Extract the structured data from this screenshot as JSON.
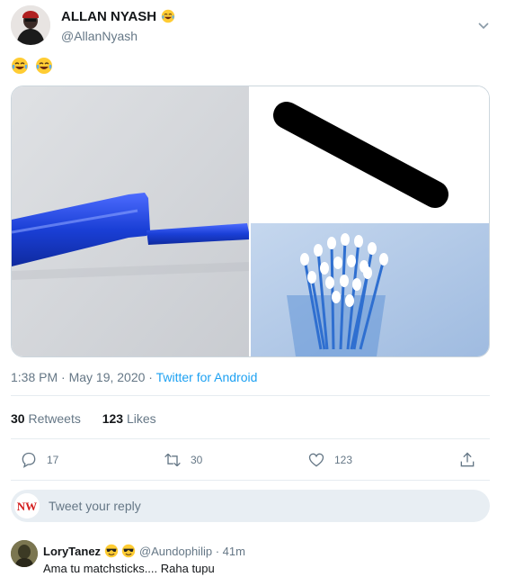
{
  "header": {
    "display_name": "ALLAN NYASH",
    "handle": "@AllanNyash",
    "name_emoji": "tears-of-joy-emoji"
  },
  "tweet": {
    "text_emojis": [
      "tears-of-joy-emoji",
      "tears-of-joy-emoji"
    ],
    "media": [
      {
        "name": "blue-pen-cap-photo"
      },
      {
        "name": "black-stroke-photo"
      },
      {
        "name": "cotton-swabs-photo"
      }
    ],
    "time": "1:38 PM · May 19, 2020 · ",
    "source": "Twitter for Android"
  },
  "stats": {
    "retweets_count": "30",
    "retweets_label": "Retweets",
    "likes_count": "123",
    "likes_label": "Likes"
  },
  "actions": {
    "reply_count": "17",
    "retweet_count": "30",
    "like_count": "123"
  },
  "reply_box": {
    "placeholder": "Tweet your reply",
    "avatar_text": "NW"
  },
  "reply": {
    "name": "LoryTanez",
    "name_emojis": [
      "sunglasses-emoji",
      "sunglasses-emoji"
    ],
    "meta": "@Aundophilip · 41m",
    "text": "Ama tu matchsticks.... Raha tupu"
  },
  "colors": {
    "accent": "#1da1f2",
    "secondary_text": "#657786",
    "border": "#e6ecf0",
    "pen_blue": "#1a3fd6"
  }
}
